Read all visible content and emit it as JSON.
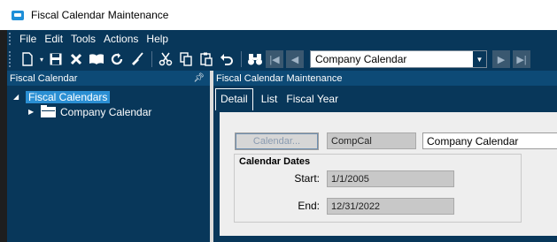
{
  "window": {
    "title": "Fiscal Calendar Maintenance"
  },
  "menu": [
    "File",
    "Edit",
    "Tools",
    "Actions",
    "Help"
  ],
  "toolbar": {
    "record_selector": {
      "value": "Company Calendar"
    }
  },
  "left_panel": {
    "title": "Fiscal Calendar",
    "tree": {
      "root_label": "Fiscal Calendars",
      "children": [
        {
          "label": "Company Calendar"
        }
      ]
    }
  },
  "right_panel": {
    "title": "Fiscal Calendar Maintenance",
    "tabs": [
      "Detail",
      "List",
      "Fiscal Year"
    ],
    "active_tab": "Detail",
    "form": {
      "calendar_button_label": "Calendar...",
      "calendar_id": "CompCal",
      "calendar_description": "Company Calendar",
      "group_title": "Calendar Dates",
      "start_label": "Start:",
      "start_value": "1/1/2005",
      "end_label": "End:",
      "end_value": "12/31/2022"
    }
  },
  "colors": {
    "panel_bg": "#08375a",
    "header_bg": "#0d4a76",
    "selection": "#2b8fd3",
    "form_bg": "#eeeeee"
  }
}
